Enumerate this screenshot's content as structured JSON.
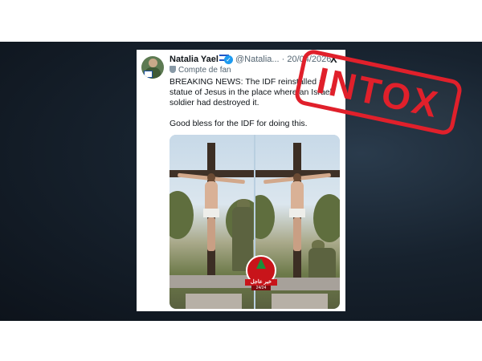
{
  "tweet": {
    "author_name": "Natalia Yael",
    "handle_date": "@Natalia... · 20/04/2026",
    "badge_label": "Compte de fan",
    "text_line1": "BREAKING NEWS: The IDF reinstalled a statue of Jesus in the place where an Israeli soldier had destroyed it.",
    "text_line2": "Good bless for the IDF for doing this.",
    "platform_logo": "X"
  },
  "media": {
    "watermark_line1": "خبر عاجل",
    "watermark_line2": "24/24"
  },
  "stamp": {
    "label": "INTOX",
    "color": "#e0202b"
  },
  "colors": {
    "background_band": "#111821",
    "verified": "#1d9bf0"
  }
}
